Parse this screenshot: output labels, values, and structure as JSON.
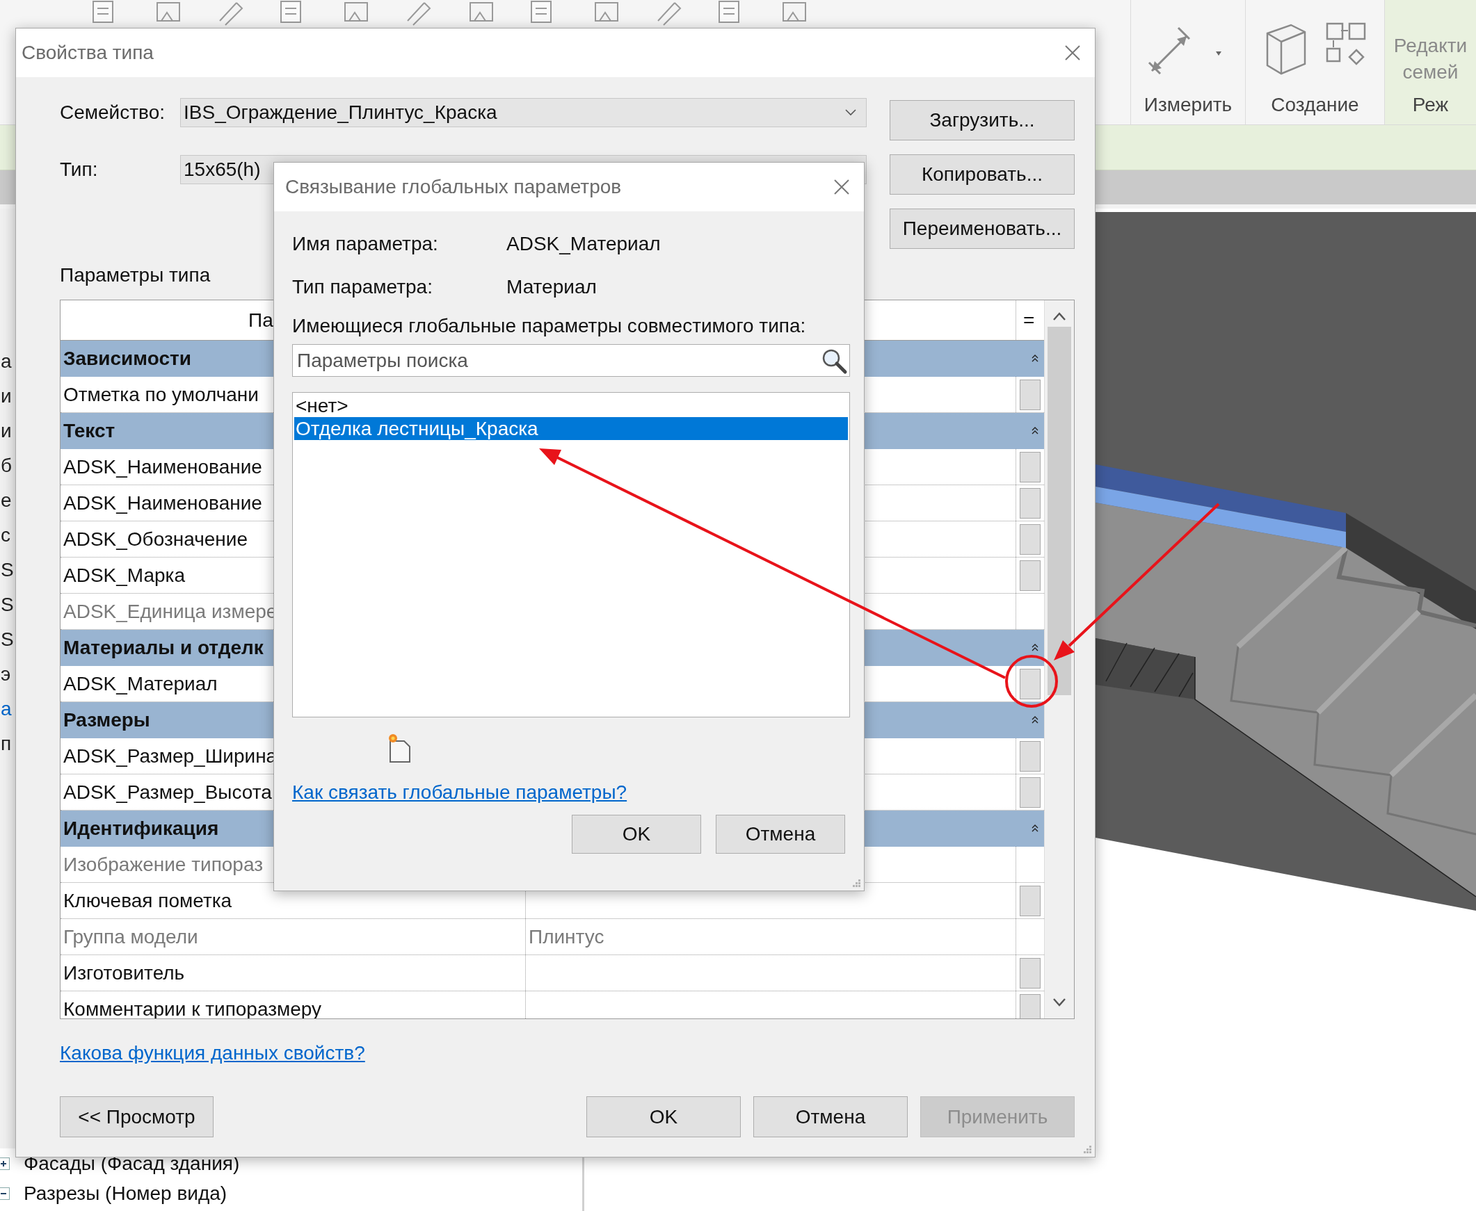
{
  "app": {
    "ribbon_panels": [
      {
        "label": "Измерить",
        "kind": "measure"
      },
      {
        "label": "Создание",
        "kind": "create"
      }
    ],
    "edit_panel": {
      "lines": [
        "Редакти",
        "семей"
      ],
      "footer": "Реж"
    },
    "left_fragments": [
      "а",
      "и",
      "и",
      "б",
      "е",
      "с",
      "S",
      "S",
      "S",
      "э",
      "а",
      "п"
    ],
    "tree_items": [
      {
        "label": "Фасады (Фасад здания)",
        "expanded": false
      },
      {
        "label": "Разрезы (Номер вида)",
        "expanded": true
      }
    ]
  },
  "type_properties": {
    "title": "Свойства типа",
    "family": {
      "label": "Семейство:",
      "value": "IBS_Ограждение_Плинтус_Краска"
    },
    "type": {
      "label": "Тип:",
      "value": "15x65(h)"
    },
    "side_buttons": [
      "Загрузить...",
      "Копировать...",
      "Переименовать..."
    ],
    "section_title": "Параметры типа",
    "table": {
      "columns": [
        "Па",
        "="
      ],
      "rows": [
        {
          "kind": "group",
          "label": "Зависимости",
          "expanded": true
        },
        {
          "kind": "param",
          "label": "Отметка по умолчани",
          "dimmed": false,
          "button": true
        },
        {
          "kind": "group",
          "label": "Текст",
          "expanded": true
        },
        {
          "kind": "param",
          "label": "ADSK_Наименование",
          "dimmed": false,
          "button": true
        },
        {
          "kind": "param",
          "label": "ADSK_Наименование",
          "dimmed": false,
          "button": true
        },
        {
          "kind": "param",
          "label": "ADSK_Обозначение",
          "dimmed": false,
          "button": true
        },
        {
          "kind": "param",
          "label": "ADSK_Марка",
          "dimmed": false,
          "button": true
        },
        {
          "kind": "param",
          "label": "ADSK_Единица измере",
          "dimmed": true,
          "button": false
        },
        {
          "kind": "group",
          "label": "Материалы и отделк",
          "expanded": true
        },
        {
          "kind": "param",
          "label": "ADSK_Материал",
          "dimmed": false,
          "button": true
        },
        {
          "kind": "group",
          "label": "Размеры",
          "expanded": true
        },
        {
          "kind": "param",
          "label": "ADSK_Размер_Ширина",
          "dimmed": false,
          "button": true
        },
        {
          "kind": "param",
          "label": "ADSK_Размер_Высота",
          "dimmed": false,
          "button": true
        },
        {
          "kind": "group",
          "label": "Идентификация",
          "expanded": true
        },
        {
          "kind": "param",
          "label": "Изображение типораз",
          "dimmed": true,
          "button": false
        },
        {
          "kind": "param",
          "label": "Ключевая пометка",
          "dimmed": false,
          "button": true
        },
        {
          "kind": "param",
          "label": "Группа модели",
          "value": "Плинтус",
          "dimmed": true,
          "button": false
        },
        {
          "kind": "param",
          "label": "Изготовитель",
          "dimmed": false,
          "button": true
        },
        {
          "kind": "param",
          "label": "Комментарии к типоразмеру",
          "dimmed": false,
          "button": true
        }
      ]
    },
    "help_link": "Какова функция данных свойств?",
    "footer_buttons": [
      {
        "label": "<< Просмотр",
        "disabled": false
      },
      {
        "label": "OK",
        "disabled": false
      },
      {
        "label": "Отмена",
        "disabled": false
      },
      {
        "label": "Применить",
        "disabled": true
      }
    ]
  },
  "link_dialog": {
    "title": "Связывание глобальных параметров",
    "fields": [
      {
        "label": "Имя параметра:",
        "value": "ADSK_Материал"
      },
      {
        "label": "Тип параметра:",
        "value": "Материал"
      }
    ],
    "list_label": "Имеющиеся глобальные параметры совместимого типа:",
    "search": {
      "placeholder": "Параметры поиска"
    },
    "items": [
      {
        "label": "<нет>",
        "selected": false
      },
      {
        "label": "Отделка лестницы_Краска",
        "selected": true
      }
    ],
    "help_link": "Как связать глобальные параметры?",
    "buttons": [
      "OK",
      "Отмена"
    ]
  }
}
